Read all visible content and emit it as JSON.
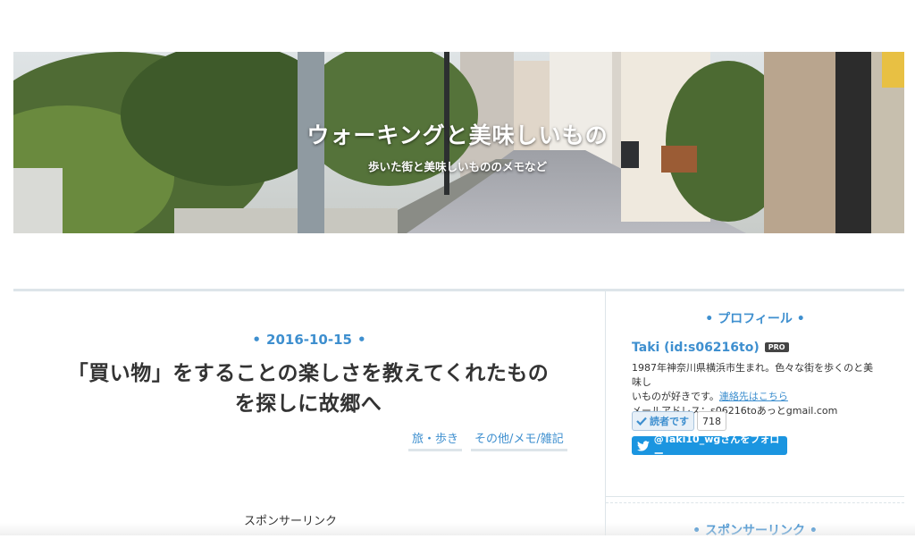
{
  "header": {
    "blog_title": "ウォーキングと美味しいもの",
    "blog_description": "歩いた街と美味しいもののメモなど"
  },
  "entry": {
    "date": "2016-10-15",
    "title_line1": "「買い物」をすることの楽しさを教えてくれたもの",
    "title_line2": "を探しに故郷へ",
    "categories": [
      "旅・歩き",
      "その他/メモ/雑記"
    ],
    "sponsored_label": "スポンサーリンク"
  },
  "sidebar": {
    "profile_heading": "プロフィール",
    "profile_name": "Taki (id:s06216to)",
    "pro_badge": "PRO",
    "profile_line1": "1987年神奈川県横浜市生まれ。色々な街を歩くのと美味し",
    "profile_line2": "いものが好きです。",
    "contact_link": "連絡先はこちら",
    "email_line": "メールアドレス：s06216toあっとgmail.com",
    "reader_button": "読者です",
    "reader_count": "718",
    "follow_button": "@Taki10_wgさんをフォロー",
    "sponsored_heading": "スポンサーリンク"
  },
  "colors": {
    "accent": "#3e8fcf",
    "twitter": "#1b95e0",
    "border": "#dde5e9"
  },
  "icons": [
    "check-icon",
    "twitter-bird-icon"
  ]
}
